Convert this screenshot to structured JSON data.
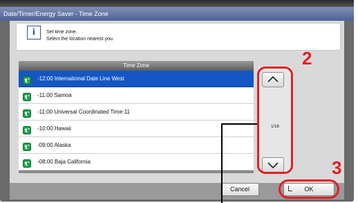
{
  "window": {
    "title": "Date/Timer/Energy Saver - Time Zone"
  },
  "message": {
    "line1": "Set time zone.",
    "line2": "Select the location nearest you."
  },
  "table": {
    "header": "Time Zone",
    "rows": [
      {
        "label": "-12:00 International Date Line West",
        "selected": true
      },
      {
        "label": "-11:00 Samoa",
        "selected": false
      },
      {
        "label": "-11:00 Universal Coordinated Time-11",
        "selected": false
      },
      {
        "label": "-10:00 Hawaii",
        "selected": false
      },
      {
        "label": "-09:00 Alaska",
        "selected": false
      },
      {
        "label": "-08:00 Baja California",
        "selected": false
      }
    ]
  },
  "pager": {
    "text": "1/16"
  },
  "buttons": {
    "cancel": "Cancel",
    "ok": "OK"
  },
  "callouts": {
    "scroll": "2",
    "ok": "3"
  },
  "colors": {
    "accent_red": "#e31e24",
    "selected_row": "#1457c4",
    "title_bar": "#4d6299"
  },
  "icons": {
    "info": "i",
    "row_icon": "globe-icon",
    "up": "chevron-up-icon",
    "down": "chevron-down-icon"
  }
}
